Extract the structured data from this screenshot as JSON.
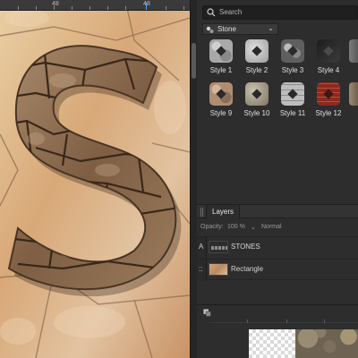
{
  "ruler": {
    "labels": [
      "48",
      "48"
    ]
  },
  "search": {
    "placeholder": "Search"
  },
  "category": {
    "selected": "Stone"
  },
  "styles": [
    {
      "label": "Style 1"
    },
    {
      "label": "Style 2"
    },
    {
      "label": "Style 3"
    },
    {
      "label": "Style 4"
    },
    {
      "label": "Style 9"
    },
    {
      "label": "Style 10"
    },
    {
      "label": "Style 11"
    },
    {
      "label": "Style 12"
    }
  ],
  "layers_panel": {
    "tab_label": "Layers",
    "opacity_label": "Opacity:",
    "opacity_value": "100 %",
    "blend_mode": "Normal",
    "layers": [
      {
        "name": "STONES",
        "type_icon": "A"
      },
      {
        "name": "Rectangle",
        "type_icon": "::"
      }
    ]
  },
  "colors": {
    "panel_bg": "#2d2d2d",
    "text": "#e0e0e0",
    "canvas_stone_light": "#d9b88a",
    "letter_stone": "#8b6d52"
  }
}
